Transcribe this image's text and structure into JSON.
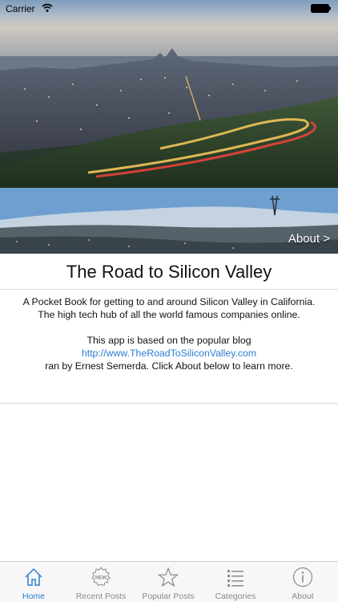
{
  "status_bar": {
    "carrier": "Carrier"
  },
  "hero": {
    "about_link": "About >"
  },
  "main": {
    "title": "The Road to Silicon Valley",
    "description": "A Pocket Book for getting to and around Silicon Valley in California. The high tech hub of all the world famous companies online.",
    "based_on": "This app is based on the popular blog",
    "blog_url": "http://www.TheRoadToSiliconValley.com",
    "author_line": "ran by Ernest Semerda. Click About below to learn more."
  },
  "tabbar": {
    "tabs": [
      {
        "label": "Home",
        "icon": "home-icon",
        "active": true
      },
      {
        "label": "Recent Posts",
        "icon": "new-badge-icon",
        "active": false
      },
      {
        "label": "Popular Posts",
        "icon": "star-icon",
        "active": false
      },
      {
        "label": "Categories",
        "icon": "list-icon",
        "active": false
      },
      {
        "label": "About",
        "icon": "info-icon",
        "active": false
      }
    ]
  },
  "colors": {
    "accent": "#2a7ed2",
    "inactive": "#8a8a8a",
    "tabbar_bg": "#f7f7f7"
  }
}
